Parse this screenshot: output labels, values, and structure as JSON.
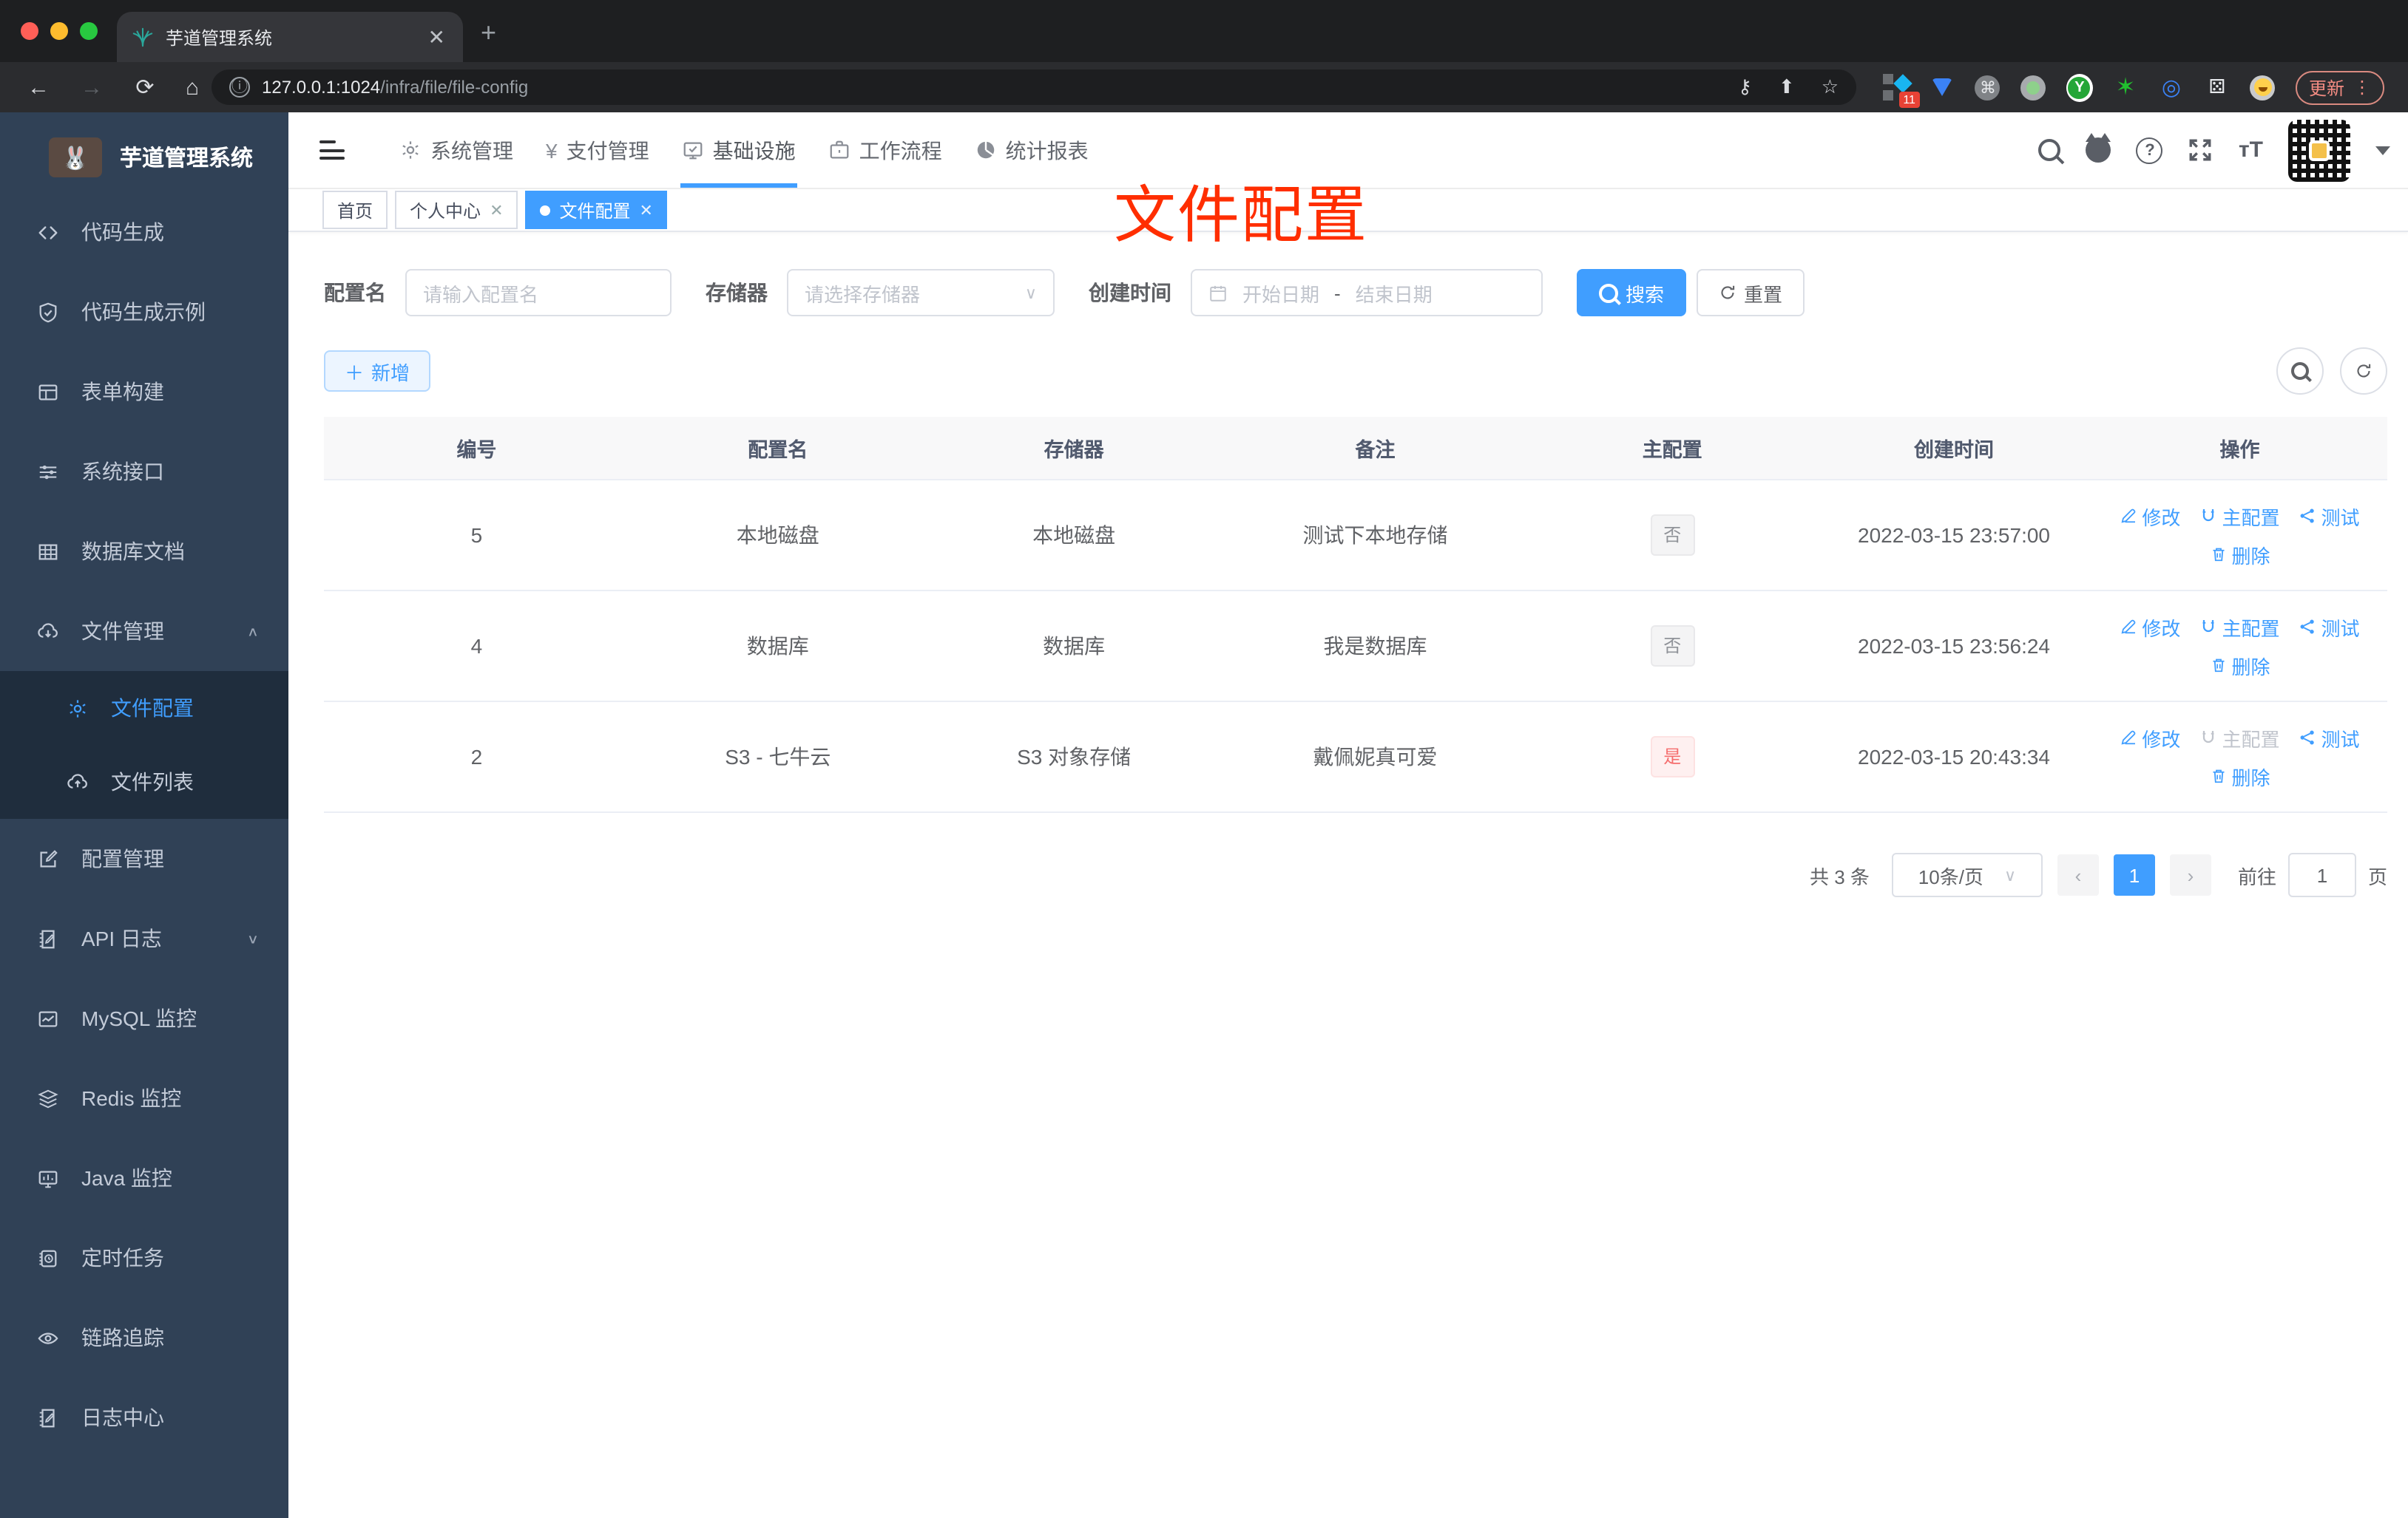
{
  "browser": {
    "tab_title": "芋道管理系统",
    "url_host": "127.0.0.1:1024",
    "url_path": "/infra/file/file-config",
    "extension_badge": "11",
    "update_label": "更新"
  },
  "sidebar": {
    "app_title": "芋道管理系统",
    "items": [
      {
        "label": "代码生成",
        "icon": "code-icon"
      },
      {
        "label": "代码生成示例",
        "icon": "shield-check-icon"
      },
      {
        "label": "表单构建",
        "icon": "form-icon"
      },
      {
        "label": "系统接口",
        "icon": "sliders-icon"
      },
      {
        "label": "数据库文档",
        "icon": "table-grid-icon"
      },
      {
        "label": "文件管理",
        "icon": "cloud-download-icon"
      },
      {
        "label": "文件配置",
        "icon": "gear-icon"
      },
      {
        "label": "文件列表",
        "icon": "cloud-upload-icon"
      },
      {
        "label": "配置管理",
        "icon": "edit-square-icon"
      },
      {
        "label": "API 日志",
        "icon": "edit-document-icon"
      },
      {
        "label": "MySQL 监控",
        "icon": "chart-box-icon"
      },
      {
        "label": "Redis 监控",
        "icon": "layers-icon"
      },
      {
        "label": "Java 监控",
        "icon": "monitor-icon"
      },
      {
        "label": "定时任务",
        "icon": "schedule-icon"
      },
      {
        "label": "链路追踪",
        "icon": "eye-icon"
      },
      {
        "label": "日志中心",
        "icon": "log-edit-icon"
      }
    ]
  },
  "topnav": {
    "items": [
      {
        "label": "系统管理",
        "icon": "gear-icon"
      },
      {
        "label": "支付管理",
        "icon": "yen-icon"
      },
      {
        "label": "基础设施",
        "icon": "monitor-check-icon"
      },
      {
        "label": "工作流程",
        "icon": "briefcase-icon"
      },
      {
        "label": "统计报表",
        "icon": "pie-chart-icon"
      }
    ],
    "active": "基础设施"
  },
  "tags": [
    {
      "label": "首页"
    },
    {
      "label": "个人中心",
      "closable": true
    },
    {
      "label": "文件配置",
      "active": true,
      "closable": true
    }
  ],
  "annotation": {
    "text": "文件配置",
    "color": "#ff2e00"
  },
  "filters": {
    "config_name_label": "配置名",
    "config_name_placeholder": "请输入配置名",
    "storage_label": "存储器",
    "storage_placeholder": "请选择存储器",
    "create_time_label": "创建时间",
    "start_placeholder": "开始日期",
    "range_separator": "-",
    "end_placeholder": "结束日期",
    "search_label": "搜索",
    "reset_label": "重置"
  },
  "toolbar": {
    "add_label": "新增"
  },
  "table": {
    "columns": [
      "编号",
      "配置名",
      "存储器",
      "备注",
      "主配置",
      "创建时间",
      "操作"
    ],
    "action_labels": {
      "edit": "修改",
      "master": "主配置",
      "test": "测试",
      "delete": "删除"
    },
    "rows": [
      {
        "id": "5",
        "name": "本地磁盘",
        "storage": "本地磁盘",
        "remark": "测试下本地存储",
        "master": "否",
        "master_type": "info",
        "created": "2022-03-15 23:57:00"
      },
      {
        "id": "4",
        "name": "数据库",
        "storage": "数据库",
        "remark": "我是数据库",
        "master": "否",
        "master_type": "info",
        "created": "2022-03-15 23:56:24"
      },
      {
        "id": "2",
        "name": "S3 - 七牛云",
        "storage": "S3 对象存储",
        "remark": "戴佩妮真可爱",
        "master": "是",
        "master_type": "danger",
        "created": "2022-03-15 20:43:34"
      }
    ]
  },
  "pagination": {
    "total_text": "共 3 条",
    "page_size": "10条/页",
    "current_page": "1",
    "goto_label": "前往",
    "goto_value": "1",
    "page_suffix": "页"
  },
  "colors": {
    "accent": "#409eff",
    "sidebar_bg": "#304156",
    "submenu_bg": "#1f2d3d",
    "danger": "#f56c6c",
    "annotation_red": "#ff2e00"
  }
}
